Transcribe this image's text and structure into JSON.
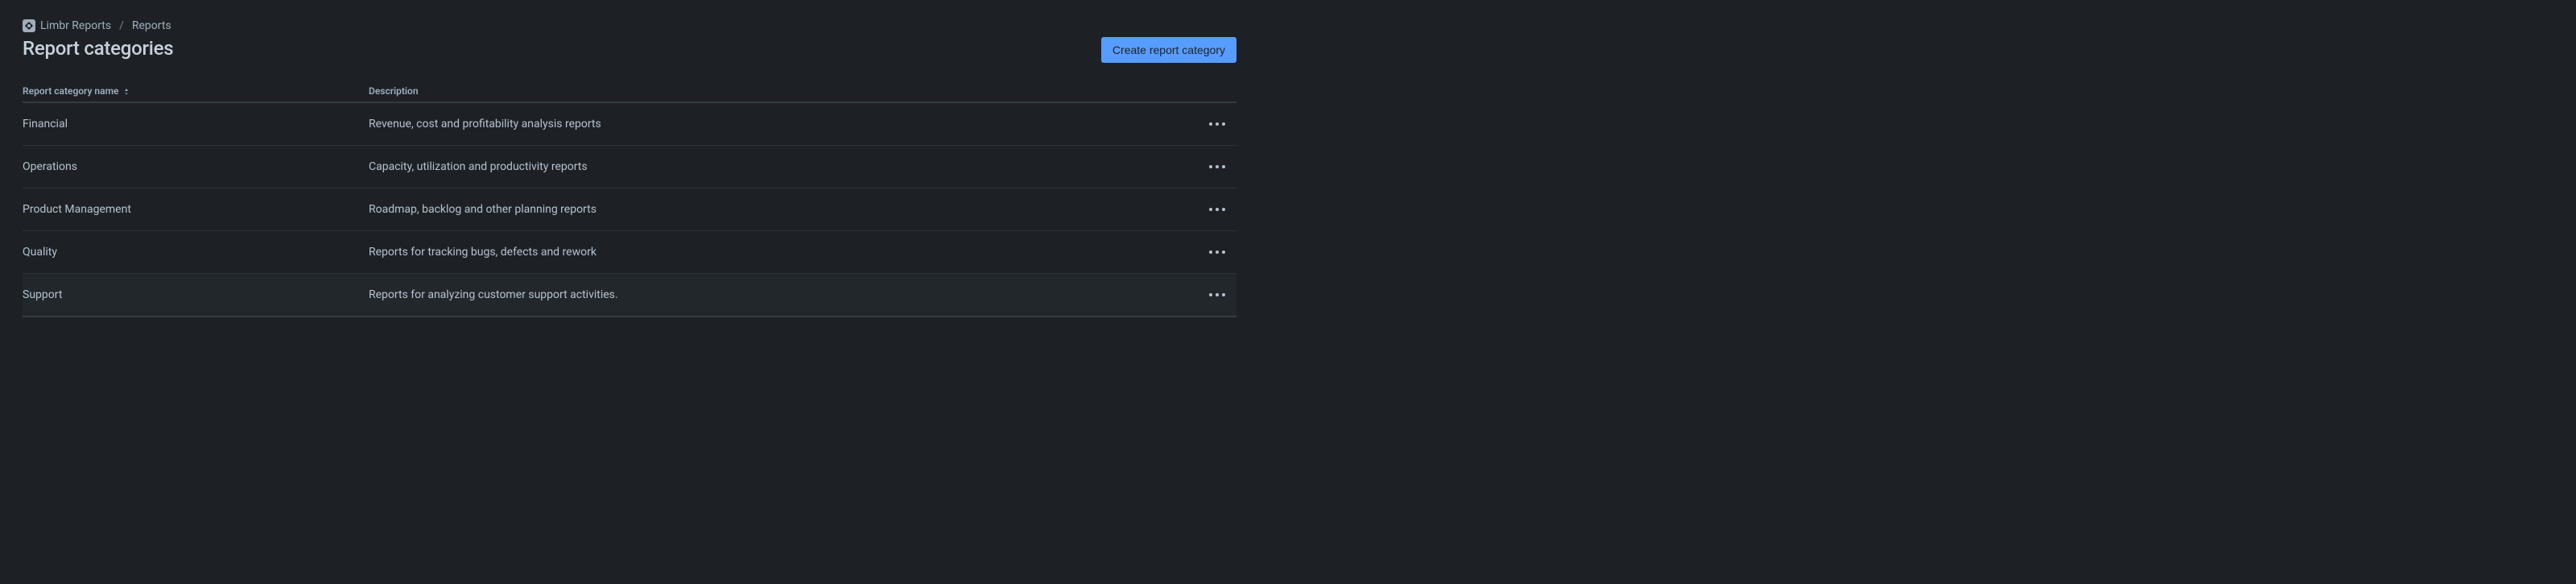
{
  "breadcrumb": {
    "items": [
      "Limbr Reports",
      "Reports"
    ]
  },
  "header": {
    "title": "Report categories",
    "createButton": "Create report category"
  },
  "table": {
    "columns": {
      "name": "Report category name",
      "description": "Description"
    },
    "rows": [
      {
        "name": "Financial",
        "description": "Revenue, cost and profitability analysis reports",
        "highlight": false
      },
      {
        "name": "Operations",
        "description": "Capacity, utilization and productivity reports",
        "highlight": false
      },
      {
        "name": "Product Management",
        "description": "Roadmap, backlog and other planning reports",
        "highlight": false
      },
      {
        "name": "Quality",
        "description": "Reports for tracking bugs, defects and rework",
        "highlight": false
      },
      {
        "name": "Support",
        "description": "Reports for analyzing customer support activities.",
        "highlight": true
      }
    ]
  }
}
